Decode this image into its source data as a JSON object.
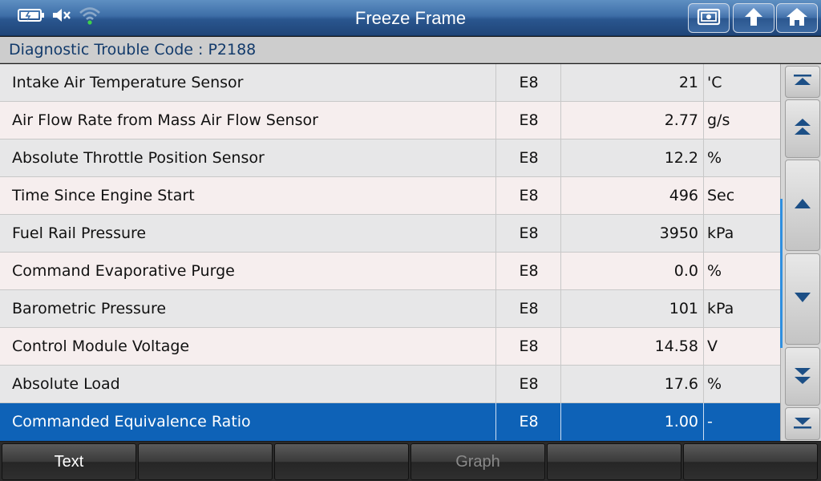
{
  "window": {
    "title": "Freeze Frame"
  },
  "dtc": {
    "label": "Diagnostic Trouble Code : P2188"
  },
  "rows": [
    {
      "name": "Intake Air Temperature Sensor",
      "code": "E8",
      "value": "21",
      "unit": "'C"
    },
    {
      "name": "Air Flow Rate from Mass Air Flow Sensor",
      "code": "E8",
      "value": "2.77",
      "unit": "g/s"
    },
    {
      "name": "Absolute Throttle Position Sensor",
      "code": "E8",
      "value": "12.2",
      "unit": "%"
    },
    {
      "name": "Time Since Engine Start",
      "code": "E8",
      "value": "496",
      "unit": "Sec"
    },
    {
      "name": "Fuel Rail Pressure",
      "code": "E8",
      "value": "3950",
      "unit": "kPa"
    },
    {
      "name": "Command Evaporative Purge",
      "code": "E8",
      "value": "0.0",
      "unit": "%"
    },
    {
      "name": "Barometric Pressure",
      "code": "E8",
      "value": "101",
      "unit": "kPa"
    },
    {
      "name": "Control Module Voltage",
      "code": "E8",
      "value": "14.58",
      "unit": "V"
    },
    {
      "name": "Absolute Load",
      "code": "E8",
      "value": "17.6",
      "unit": "%"
    },
    {
      "name": "Commanded Equivalence Ratio",
      "code": "E8",
      "value": "1.00",
      "unit": "-"
    }
  ],
  "selected_row": 9,
  "toolbar": [
    {
      "label": "Text",
      "enabled": true
    },
    {
      "label": "",
      "enabled": true
    },
    {
      "label": "",
      "enabled": true
    },
    {
      "label": "Graph",
      "enabled": false
    },
    {
      "label": "",
      "enabled": true
    },
    {
      "label": "",
      "enabled": true
    }
  ],
  "icons": {
    "status": [
      "battery-icon",
      "speaker-muted-icon",
      "wifi-icon"
    ],
    "title_buttons": [
      "screenshot-icon",
      "back-icon",
      "home-icon"
    ],
    "scroll": [
      "scroll-top-icon",
      "page-up-icon",
      "line-up-icon",
      "line-down-icon",
      "page-down-icon",
      "scroll-bottom-icon"
    ]
  },
  "colors": {
    "titlebar": "#3d6ea7",
    "selected_row": "#0e62b7",
    "dtc_text": "#123a6b",
    "scroll_indicator": "#2f8fe0"
  }
}
